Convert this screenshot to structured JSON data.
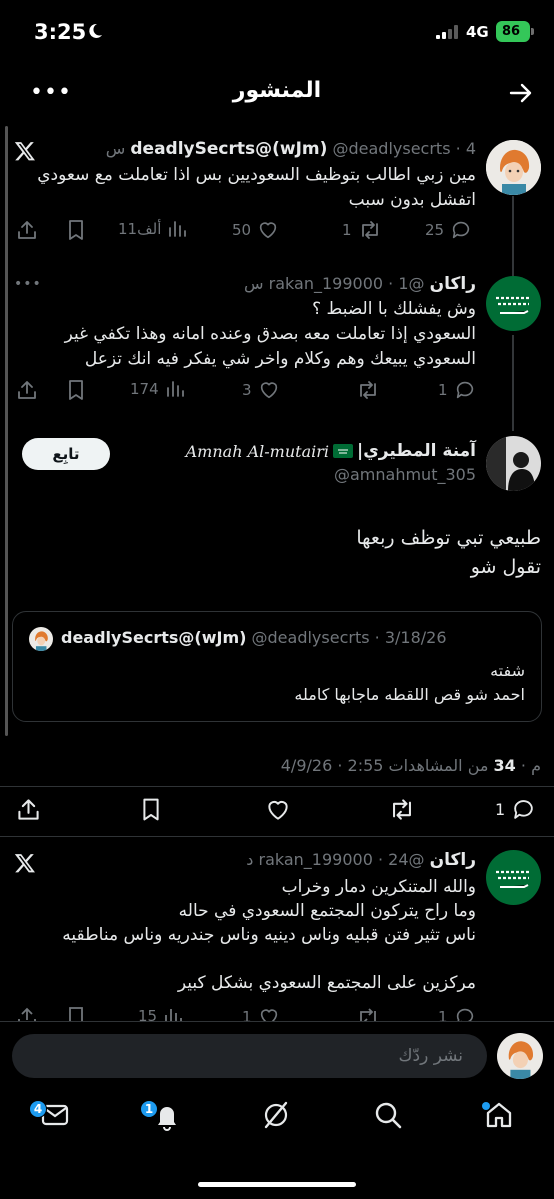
{
  "status_bar": {
    "time": "3:25",
    "network": "4G",
    "battery": "86"
  },
  "header": {
    "title": "المنشور"
  },
  "posts": [
    {
      "name": "deadlySecrts@(wJm)",
      "handle": "@deadlysecrts",
      "time": "· 4 س",
      "text_lines": [
        "مين زبي اطالب بتوظيف السعوديين بس اذا تعاملت مع سعودي",
        "اتفشل بدون سبب"
      ],
      "replies": "25",
      "reposts": "1",
      "likes": "50",
      "views": "11ألف"
    },
    {
      "name": "راكان",
      "handle": "@rakan_199000",
      "time": "· 1 س",
      "text_lines": [
        "وش يفشلك با الضبط ؟",
        "السعودي إذا تعاملت معه بصدق وعنده امانه وهذا تكفي غير",
        "السعودي يبيعك وهم وكلام واخر شي يفكر فيه انك تزعل"
      ],
      "replies": "1",
      "reposts": "",
      "likes": "3",
      "views": "174"
    }
  ],
  "main_post": {
    "name": "آمنة المطيري|",
    "name_latin": "𝐴𝑚𝑛𝑎ℎ 𝐴𝑙-𝑚𝑢𝑡𝑎𝑖𝑟𝑖",
    "handle": "@amnahmut_305",
    "follow_label": "تابِع",
    "text_lines": [
      "طبيعي تبي توظف ربعها",
      "تقول شو"
    ],
    "quote": {
      "name": "deadlySecrts@(wJm)",
      "handle": "@deadlysecrts",
      "date": "· 3/18/26",
      "text_lines": [
        "شفته",
        "احمد شو قص اللقطه ماجابها كامله"
      ]
    },
    "meta": {
      "time": "2:55 م",
      "date": "4/9/26",
      "views_count": "34",
      "views_label": "من المشاهدات"
    },
    "replies": "1"
  },
  "reply_post": {
    "name": "راكان",
    "handle": "@rakan_199000",
    "time": "· 24 د",
    "text_lines": [
      "والله المتنكرين دمار وخراب",
      "وما راح يتركون المجتمع السعودي في حاله",
      "ناس تثير فتن قبليه وناس دينيه وناس جندريه وناس مناطقيه",
      "",
      "مركزين على المجتمع السعودي بشكل كبير"
    ],
    "replies": "1",
    "likes": "1",
    "views": "15"
  },
  "reply_bar": {
    "placeholder": "نشر ردّك"
  },
  "tabbar": {
    "messages_badge": "4",
    "notifications_badge": "1"
  },
  "colors": {
    "accent": "#1d9bf0",
    "battery": "#34c759",
    "flag_green": "#006c35"
  }
}
